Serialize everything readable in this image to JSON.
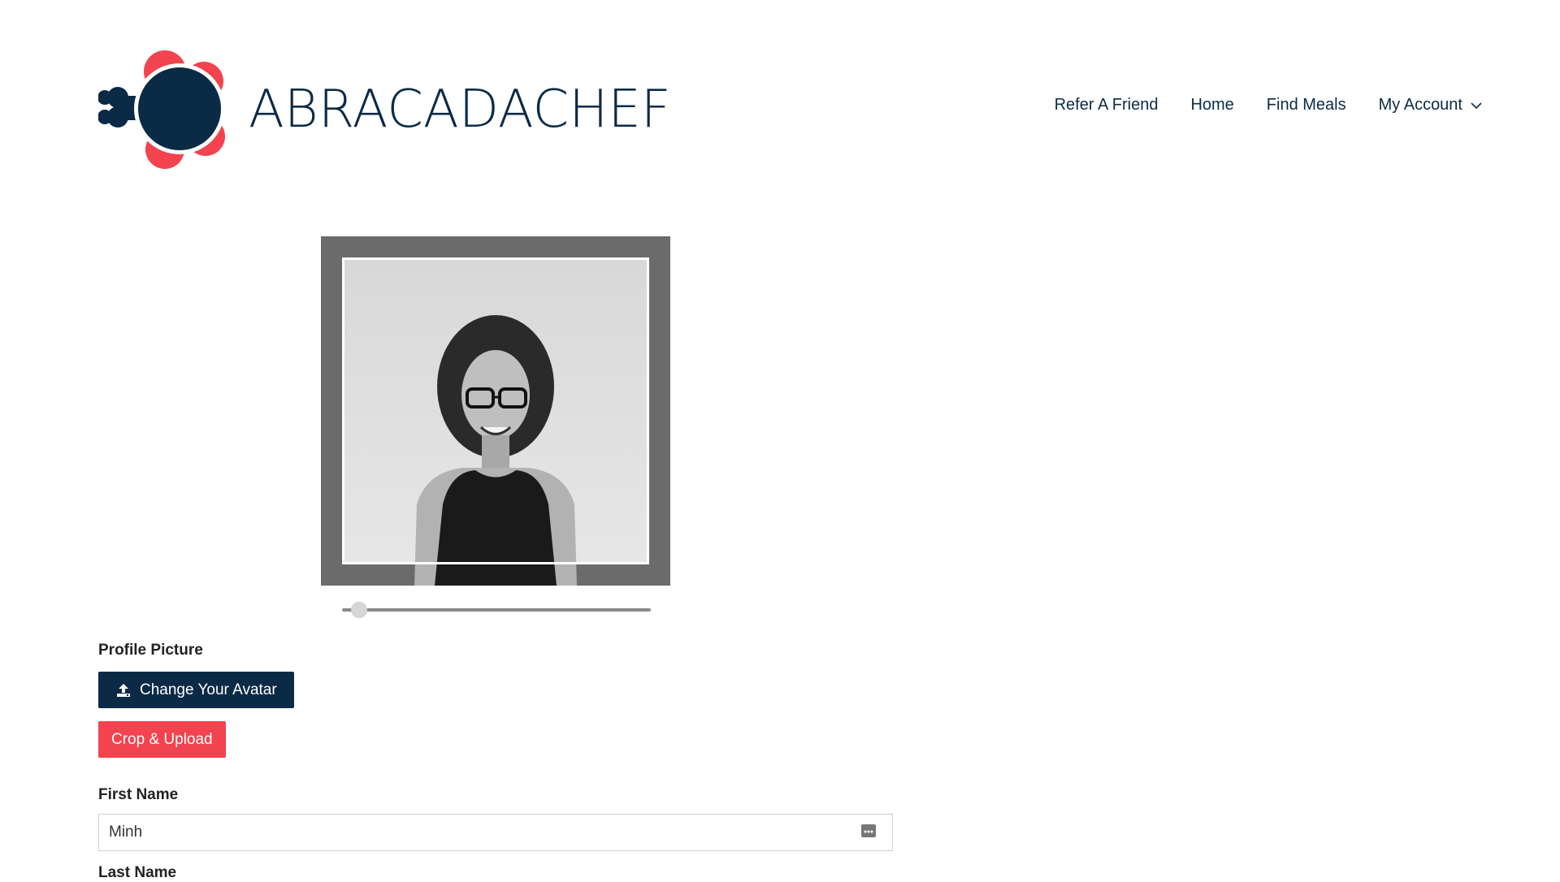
{
  "brand": {
    "name": "ABRACADACHEF",
    "colors": {
      "navy": "#0b2a45",
      "coral": "#f2434f"
    }
  },
  "nav": {
    "items": [
      {
        "label": "Refer A Friend"
      },
      {
        "label": "Home"
      },
      {
        "label": "Find Meals"
      },
      {
        "label": "My Account",
        "icon": "chevron-down-icon"
      }
    ]
  },
  "cropper": {
    "zoom_level": 0.03
  },
  "form": {
    "profile_picture_label": "Profile Picture",
    "change_avatar_label": "Change Your Avatar",
    "change_avatar_icon": "upload-icon",
    "crop_upload_label": "Crop & Upload",
    "first_name": {
      "label": "First Name",
      "value": "Minh",
      "icon": "more-dots-icon"
    },
    "last_name": {
      "label": "Last Name"
    }
  }
}
